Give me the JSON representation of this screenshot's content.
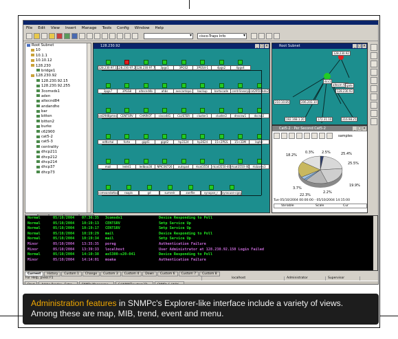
{
  "menu": [
    "File",
    "Edit",
    "View",
    "Insert",
    "Manage",
    "Tools",
    "Config",
    "Window",
    "Help"
  ],
  "toolbar": {
    "address_value": "",
    "view_select": "cisco-Traps Info"
  },
  "tree": {
    "items": [
      {
        "label": "Root Subnet",
        "type": "root"
      },
      {
        "label": "10",
        "type": "net"
      },
      {
        "label": "10.1.1",
        "type": "net"
      },
      {
        "label": "10.10.12",
        "type": "net"
      },
      {
        "label": "128.230",
        "type": "net"
      },
      {
        "label": "bridge1",
        "type": "node"
      },
      {
        "label": "128.230.92",
        "type": "net"
      },
      {
        "label": "128.230.92.15",
        "type": "node"
      },
      {
        "label": "128.230.92.255",
        "type": "node"
      },
      {
        "label": "3comsds1",
        "type": "node"
      },
      {
        "label": "aden",
        "type": "node"
      },
      {
        "label": "altecnd84",
        "type": "node"
      },
      {
        "label": "andandhe",
        "type": "node"
      },
      {
        "label": "bar",
        "type": "node"
      },
      {
        "label": "bitten",
        "type": "node"
      },
      {
        "label": "bitten2",
        "type": "node"
      },
      {
        "label": "burke",
        "type": "node"
      },
      {
        "label": "c62900",
        "type": "node"
      },
      {
        "label": "cat5-2",
        "type": "node"
      },
      {
        "label": "cat5-3",
        "type": "node"
      },
      {
        "label": "centrality",
        "type": "node"
      },
      {
        "label": "dhcp211",
        "type": "node"
      },
      {
        "label": "dhcp212",
        "type": "node"
      },
      {
        "label": "dhcp214",
        "type": "node"
      },
      {
        "label": "dhcp37",
        "type": "node"
      },
      {
        "label": "dhcp73",
        "type": "node"
      }
    ],
    "tabs": [
      "Map",
      "Mib",
      "Trend",
      "Event",
      "Menu"
    ],
    "active_tab": "Map"
  },
  "map_window": {
    "title": "128.230.92",
    "rows": [
      [
        "128.230.97.190",
        "128.230.97.222",
        "128.230.97.7",
        "3pgs1",
        "3PGS2",
        "3PGS4-1",
        "4pgs2",
        "4pgs4"
      ],
      [
        "3pgs7",
        "3PGS8",
        "altecnd4b",
        "ahbs",
        "avscantopo",
        "backup",
        "bartocade",
        "centrlineorp",
        "cat2950-bds2"
      ],
      [
        "cat2948pmno",
        "CENTSRV",
        "CHARIOT",
        "cisco441",
        "CLUSTER",
        "cluster1",
        "cluster2",
        "dnscsw1",
        "dscsw2"
      ],
      [
        "edtlsrtal",
        "forte",
        "gigd1",
        "gigd2",
        "hp3124",
        "hp3624",
        "15<2PGS",
        "15<33M",
        "lapter"
      ],
      [
        "mail",
        "ledst1",
        "ledboa30",
        "NPIC06726",
        "outspad",
        "rtcat3550",
        "rtcat3550-40",
        "rtcat3550-40",
        "rtcbares3"
      ],
      [
        "comeandattacheck",
        "raapls",
        "gd",
        "sumrelr",
        "zanfile",
        "synapse_r",
        "syracuse-cgsyh7"
      ]
    ],
    "red_node": "128.230.97.222"
  },
  "root_window": {
    "title": "Root Subnet",
    "nodes": [
      "128.230.92",
      "128.230.93",
      "dcs1",
      "altecm f10",
      "gate",
      "210.10.85",
      "206.203.10",
      "172.31.10",
      "128.230.9",
      "192.168.1.20",
      "216.98.25"
    ]
  },
  "pie_window": {
    "title": "Cat5-2 - Per Second Cat5-2",
    "toolbar_label": "samples",
    "slices": [
      {
        "label": "0.3%",
        "value": 0.3,
        "color": "#3a6a3a"
      },
      {
        "label": "2.5%",
        "value": 2.5,
        "color": "#304070"
      },
      {
        "label": "25.4%",
        "value": 25.4,
        "color": "#d8d8d8"
      },
      {
        "label": "25.5%",
        "value": 25.5,
        "color": "#cfcfcf"
      },
      {
        "label": "19.9%",
        "value": 19.9,
        "color": "#b8b8b8"
      },
      {
        "label": "2.2%",
        "value": 2.2,
        "color": "#7aa8d8"
      },
      {
        "label": "3.7%",
        "value": 3.7,
        "color": "#a0c0e0"
      },
      {
        "label": "22.3%",
        "value": 22.3,
        "color": "#c8b860"
      },
      {
        "label": "18.2%",
        "value": 18.2,
        "color": "#e0e0e0"
      }
    ],
    "range_text": "Tue 05/10/2004 00:00:00 - 05/10/2004 14:15:00",
    "col_variable": "Variable",
    "col_scale": "Scale",
    "col_cur": "Cur"
  },
  "events": [
    {
      "sev": "Normal",
      "date": "05/10/2004",
      "time": "07:36:35",
      "host": "3comsds1",
      "msg": "Device Responding to Poll",
      "color": "#22ee22"
    },
    {
      "sev": "Normal",
      "date": "05/10/2004",
      "time": "10:19:13",
      "host": "CENTSRV",
      "msg": "Smtp Service Up",
      "color": "#22ee22"
    },
    {
      "sev": "Normal",
      "date": "05/10/2004",
      "time": "10:19:17",
      "host": "CENTSRV",
      "msg": "Smtp Service Up",
      "color": "#22ee22"
    },
    {
      "sev": "Normal",
      "date": "05/10/2004",
      "time": "10:19:29",
      "host": "mail",
      "msg": "Device Responding to Poll",
      "color": "#22ee22"
    },
    {
      "sev": "Normal",
      "date": "05/10/2004",
      "time": "10:19:34",
      "host": "mail",
      "msg": "Smtp Service Up",
      "color": "#22ee22"
    },
    {
      "sev": "Minor",
      "date": "05/10/2004",
      "time": "13:35:35",
      "host": "poreg",
      "msg": "Authentication Failure",
      "color": "#c86ad8"
    },
    {
      "sev": "Minor",
      "date": "05/10/2004",
      "time": "13:39:33",
      "host": "localhost",
      "msg": "User Administrator at 128.230.92.150 Login Failed",
      "color": "#c86ad8"
    },
    {
      "sev": "Normal",
      "date": "05/10/2004",
      "time": "14:10:38",
      "host": "as5300-s20-041",
      "msg": "Device Responding to Poll",
      "color": "#22ee22"
    },
    {
      "sev": "Minor",
      "date": "05/10/2004",
      "time": "14:14:01",
      "host": "moaka",
      "msg": "Authentication Failure",
      "color": "#c86ad8"
    }
  ],
  "event_tabs": [
    "Current",
    "History",
    "Custom 1",
    "Change",
    "Custom 3",
    "Custom 4",
    "Down",
    "Custom 6",
    "Custom 7",
    "Custom 8"
  ],
  "status": {
    "help": "For Help, press F1",
    "host": "localhost",
    "user": "Administrator",
    "role": "Supervisor"
  },
  "taskbar": [
    "Start",
    "Adobe Reader - Entro...",
    "SNMPc Manageme...",
    "C:\\WINNT\\system32\\...",
    "SNMPc & Utiliti..."
  ],
  "caption": {
    "highlight": "Administration features",
    "text": " in SNMPc's Explorer-like interface include a variety of views. Among these are map, MIB, trend, event and menu."
  }
}
